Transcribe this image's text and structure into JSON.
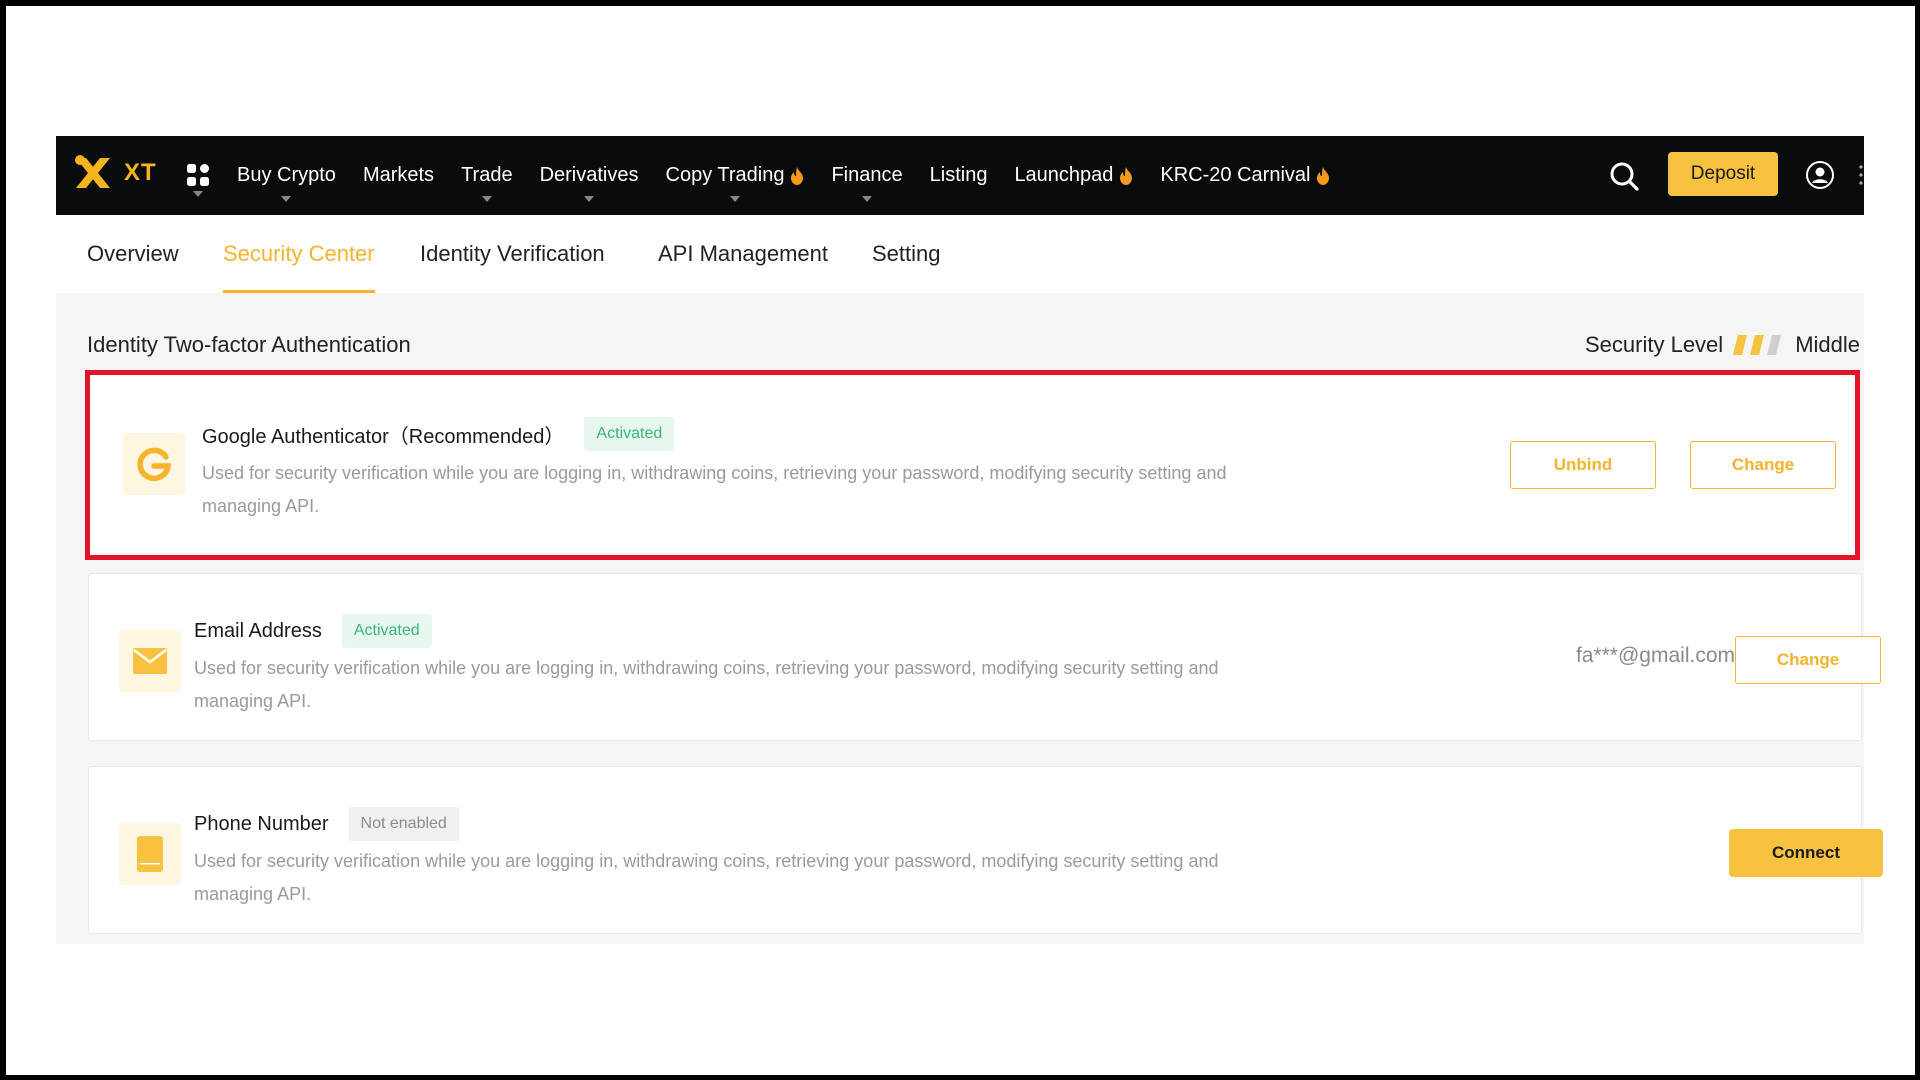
{
  "topnav": {
    "logo_text": "XT",
    "items": [
      {
        "label": "Buy Crypto"
      },
      {
        "label": "Markets"
      },
      {
        "label": "Trade"
      },
      {
        "label": "Derivatives"
      },
      {
        "label": "Copy Trading"
      },
      {
        "label": "Finance"
      },
      {
        "label": "Listing"
      },
      {
        "label": "Launchpad"
      },
      {
        "label": "KRC-20 Carnival"
      }
    ],
    "deposit_label": "Deposit"
  },
  "tabs": [
    {
      "label": "Overview"
    },
    {
      "label": "Security Center"
    },
    {
      "label": "Identity Verification"
    },
    {
      "label": "API Management"
    },
    {
      "label": "Setting"
    }
  ],
  "section": {
    "title": "Identity Two-factor Authentication",
    "security_level_label": "Security Level",
    "security_level_value": "Middle",
    "security_level_filled": 2,
    "security_level_total": 3
  },
  "cards": [
    {
      "title": "Google Authenticator（Recommended）",
      "badge": "Activated",
      "description": "Used for security verification while you are logging in, withdrawing coins, retrieving your password, modifying security setting and managing API.",
      "unbind_label": "Unbind",
      "change_label": "Change"
    },
    {
      "title": "Email Address",
      "badge": "Activated",
      "description": "Used for security verification while you are logging in, withdrawing coins, retrieving your password, modifying security setting and managing API.",
      "email": "fa***@gmail.com",
      "change_label": "Change"
    },
    {
      "title": "Phone Number",
      "badge": "Not enabled",
      "description": "Used for security verification while you are logging in, withdrawing coins, retrieving your password, modifying security setting and managing API.",
      "connect_label": "Connect"
    }
  ],
  "colors": {
    "accent": "#f5b32e",
    "button_yellow": "#f8c241",
    "nav_bg": "#0a0b0d",
    "activated_green": "#3cb47a",
    "highlight_red": "#e3142a"
  }
}
